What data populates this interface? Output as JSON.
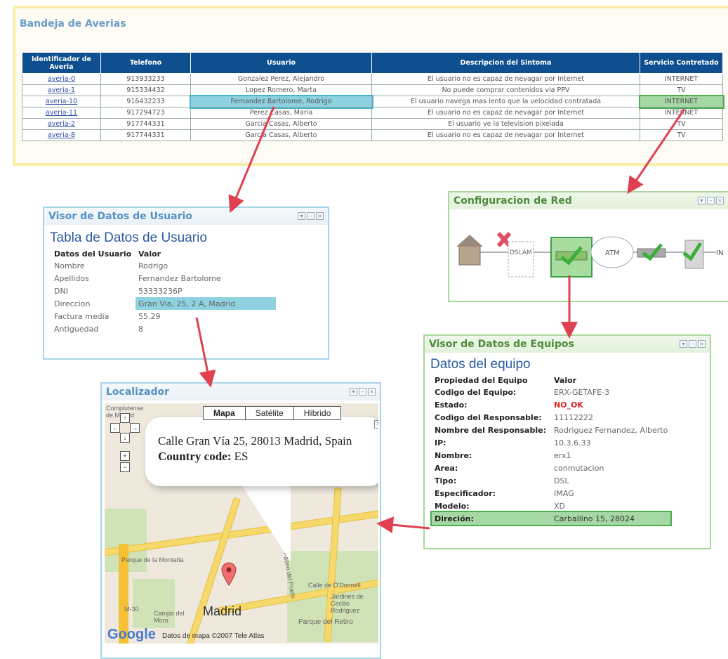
{
  "tray": {
    "title": "Bandeja de Averias",
    "columns": [
      "Identificador de Averia",
      "Telefono",
      "Usuario",
      "Descripcion del Sintoma",
      "Servicio Contretado"
    ],
    "rows": [
      [
        "averia-0",
        "913933233",
        "Gonzalez Perez, Alejandro",
        "El usuario no es capaz de nevagar por Internet",
        "INTERNET"
      ],
      [
        "averia-1",
        "915334432",
        "Lopez Romero, Marta",
        "No puede comprar contenidos via PPV",
        "TV"
      ],
      [
        "averia-10",
        "916432233",
        "Fernandez Bartolome, Rodrigo",
        "El usuario navega mas lento que la velocidad contratada",
        "INTERNET"
      ],
      [
        "averia-11",
        "917294723",
        "Perez Casas, Maria",
        "El usuario no es capaz de nevagar por Internet",
        "INTERNET"
      ],
      [
        "averia-2",
        "917744331",
        "Garcia Casas, Alberto",
        "El usuario ve la television pixelada",
        "TV"
      ],
      [
        "averia-8",
        "917744331",
        "Garcia Casas, Alberto",
        "El usuario no es capaz de nevagar por Internet",
        "TV"
      ]
    ]
  },
  "user_viewer": {
    "title": "Visor de Datos de Usuario",
    "table_title": "Tabla de Datos de Usuario",
    "col_key": "Datos del Usuario",
    "col_val": "Valor",
    "rows": [
      [
        "Nombre",
        "Rodrigo"
      ],
      [
        "Apellidos",
        "Fernandez Bartolome"
      ],
      [
        "DNI",
        "53333236P"
      ],
      [
        "Direccion",
        "Gran Via, 25, 2 A, Madrid"
      ],
      [
        "Factura media",
        "55.29"
      ],
      [
        "Antiguedad",
        "8"
      ]
    ]
  },
  "network": {
    "title": "Configuracion de Red",
    "dslam": "DSLAM",
    "atm": "ATM",
    "in": "IN"
  },
  "equipment_viewer": {
    "title": "Visor de Datos de Equipos",
    "table_title": "Datos del equipo",
    "col_key": "Propiedad del Equipo",
    "col_val": "Valor",
    "rows": [
      [
        "Codigo del Equipo:",
        "ERX-GETAFE-3"
      ],
      [
        "Estado:",
        "NO_OK"
      ],
      [
        "Codigo del Responsable:",
        "11112222"
      ],
      [
        "Nombre del Responsable:",
        "Rodriguez Fernandez, Alberto"
      ],
      [
        "IP:",
        "10.3.6.33"
      ],
      [
        "Nombre:",
        "erx1"
      ],
      [
        "Area:",
        "conmutacion"
      ],
      [
        "Tipo:",
        "DSL"
      ],
      [
        "Especificador:",
        "IMAG"
      ],
      [
        "Modelo:",
        "XD"
      ],
      [
        "Direción:",
        "Carballino 15, 28024"
      ]
    ],
    "status_color": "#e02020"
  },
  "locator": {
    "title": "Localizador",
    "map_types": [
      "Mapa",
      "Satélite",
      "Híbrido"
    ],
    "address": "Calle Gran Vía 25, 28013 Madrid, Spain",
    "country_label": "Country code:",
    "country_value": "ES",
    "city_label": "Madrid",
    "places": [
      "Complutense",
      "de Madrid",
      "Parque de la Montaña",
      "Campo del Moro",
      "Parque del Retiro",
      "Jardines de Cecilio Rodriguez",
      "M-30",
      "Calle de O'Donnell",
      "Paseo del Prado"
    ],
    "attribution": "Datos de mapa ©2007 Tele Atlas",
    "logo": "Google"
  }
}
